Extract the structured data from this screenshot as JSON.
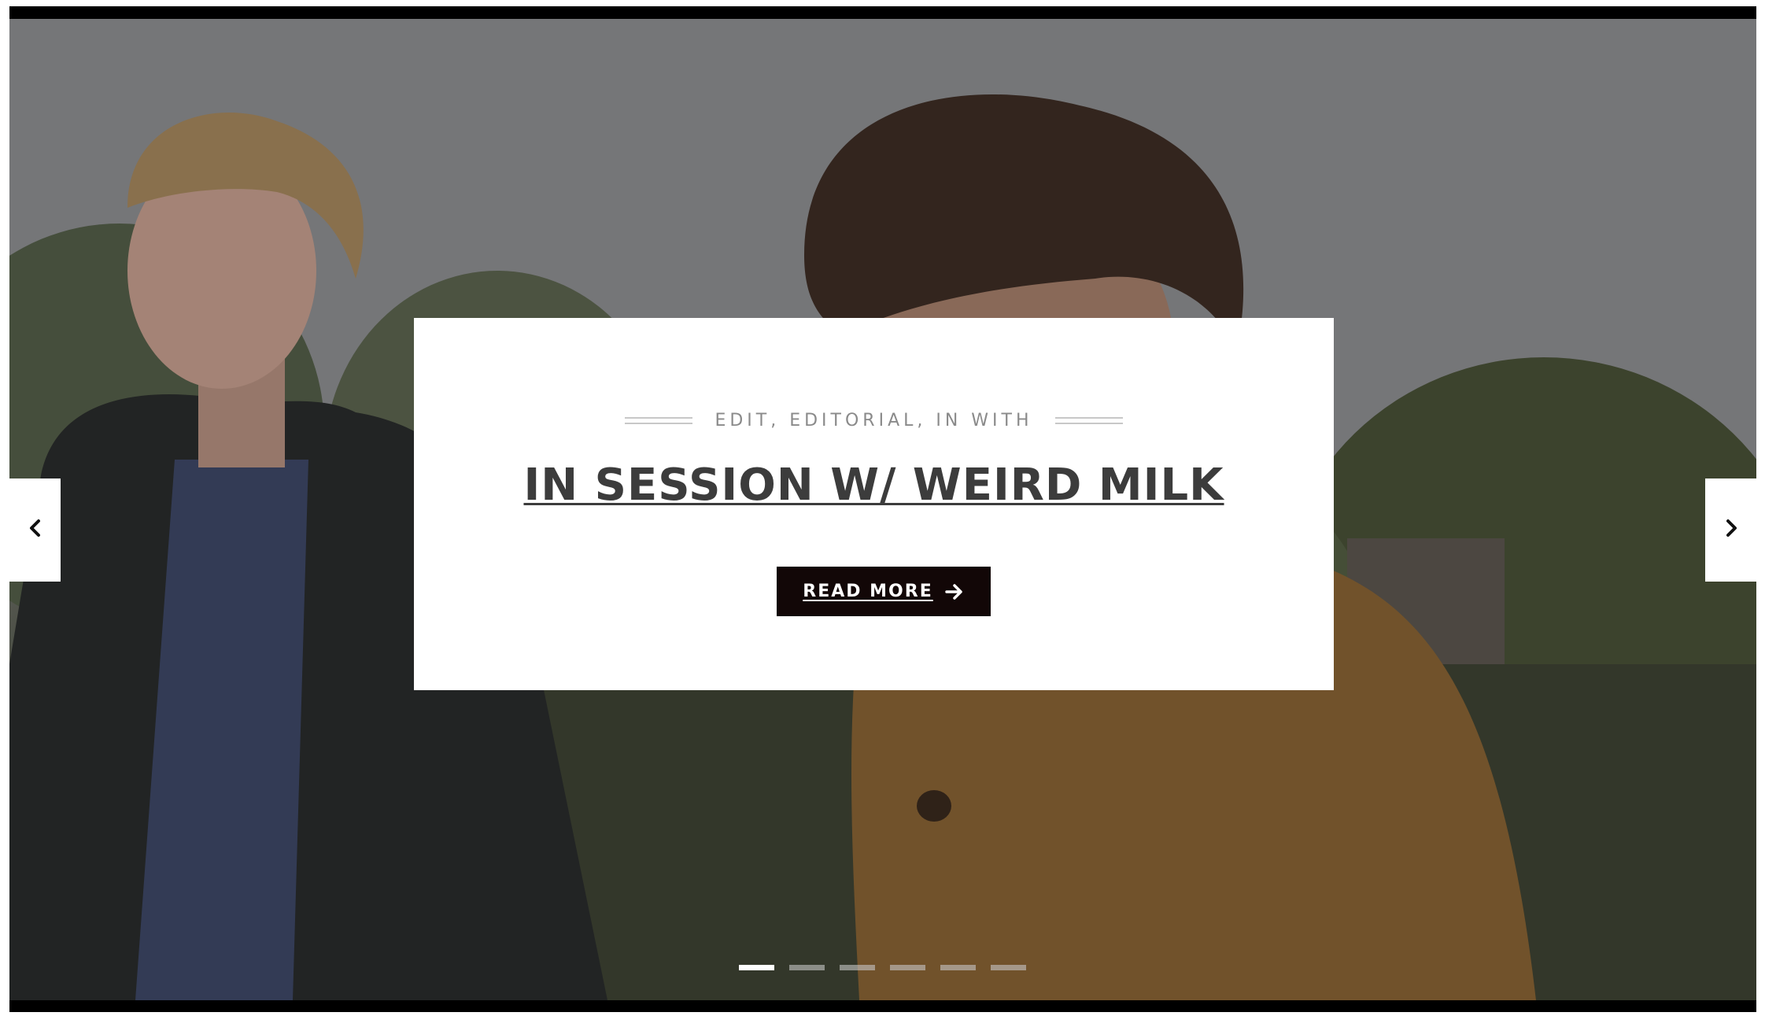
{
  "slide": {
    "categories": "EDIT, EDITORIAL, IN WITH",
    "title": "IN SESSION W/ WEIRD MILK",
    "cta_label": "READ MORE",
    "cta_icon": "arrow-right-icon"
  },
  "navigation": {
    "prev_icon": "chevron-left-icon",
    "next_icon": "chevron-right-icon"
  },
  "pagination": {
    "count": 6,
    "active_index": 0
  },
  "colors": {
    "button_bg": "#120707",
    "card_bg": "#ffffff",
    "title": "#3c3c3c",
    "meta": "#8a8a8a"
  }
}
